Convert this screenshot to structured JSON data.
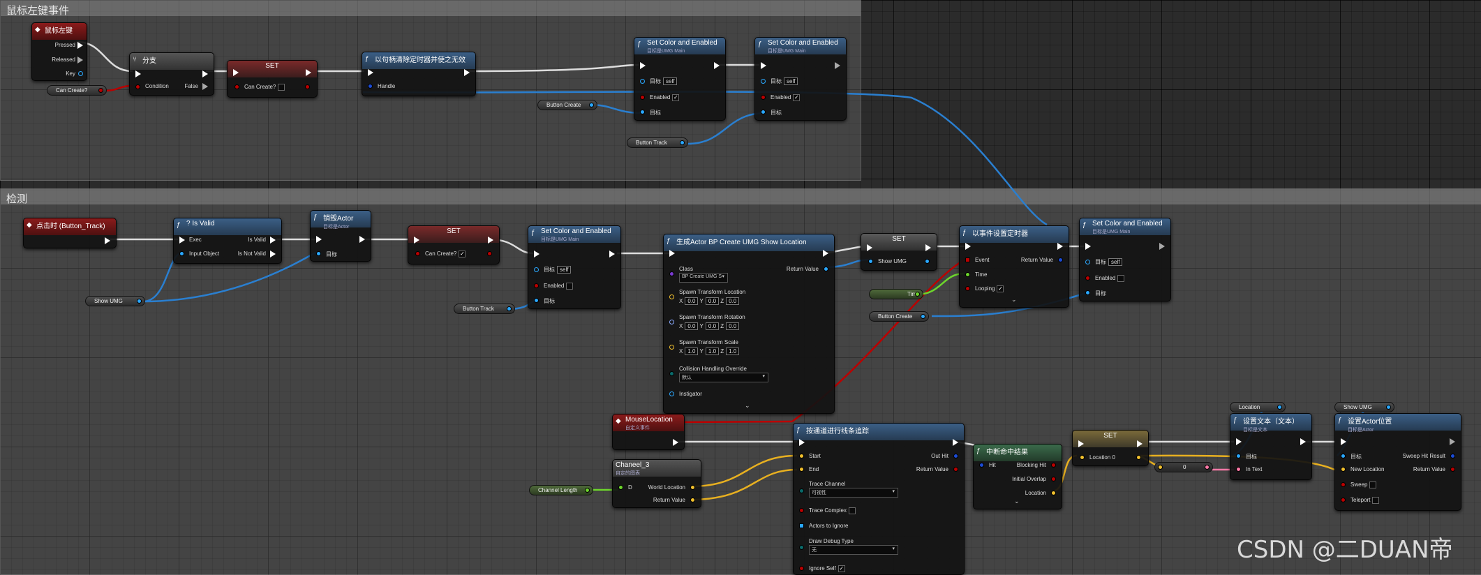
{
  "comments": {
    "top": "鼠标左键事件",
    "bottom": "检测"
  },
  "n1": {
    "title": "鼠标左键",
    "pressed": "Pressed",
    "released": "Released",
    "key": "Key"
  },
  "v_cancreate1": "Can Create?",
  "n2": {
    "title": "分支",
    "condition": "Condition",
    "false": "False"
  },
  "n3": {
    "title": "SET",
    "label": "Can Create?"
  },
  "n4": {
    "title": "以句柄清除定时器并使之无效",
    "handle": "Handle"
  },
  "n5": {
    "title": "Set Color and Enabled",
    "sub": "目标是UMG Main",
    "target": "目标",
    "self": "self",
    "enabled": "Enabled",
    "target2": "目标",
    "check": "✓"
  },
  "n6": {
    "title": "Set Color and Enabled",
    "sub": "目标是UMG Main",
    "target": "目标",
    "self": "self",
    "enabled": "Enabled",
    "target2": "目标",
    "check": "✓"
  },
  "v_btncreate1": "Button Create",
  "v_btntrack1": "Button Track",
  "b1": {
    "title": "点击时 (Button_Track)"
  },
  "b2": {
    "title": "? Is Valid",
    "exec": "Exec",
    "isvalid": "Is Valid",
    "input": "Input Object",
    "notvalid": "Is Not Valid"
  },
  "b3": {
    "title": "销毁Actor",
    "sub": "目标是Actor",
    "target": "目标"
  },
  "b4": {
    "title": "SET",
    "label": "Can Create?",
    "check": "✓"
  },
  "b5": {
    "title": "Set Color and Enabled",
    "sub": "目标是UMG Main",
    "target": "目标",
    "self": "self",
    "enabled": "Enabled",
    "target2": "目标"
  },
  "v_showumg1": "Show UMG",
  "v_btntrack2": "Button Track",
  "b6": {
    "title": "生成Actor BP Create UMG Show Location",
    "class": "Class",
    "classval": "BP Create UMG S",
    "returnv": "Return Value",
    "stl": "Spawn Transform Location",
    "str": "Spawn Transform Rotation",
    "sts": "Spawn Transform Scale",
    "x": "X",
    "y": "Y",
    "z": "Z",
    "v0": "0.0",
    "v1": "1.0",
    "coll": "Collision Handling Override",
    "collval": "默认",
    "instig": "Instigator"
  },
  "b7": {
    "title": "SET",
    "label": "Show UMG"
  },
  "b8": {
    "title": "以事件设置定时器",
    "event": "Event",
    "returnv": "Return Value",
    "time": "Time",
    "looping": "Looping",
    "check": "✓"
  },
  "b9": {
    "title": "Set Color and Enabled",
    "sub": "目标是UMG Main",
    "target": "目标",
    "self": "self",
    "enabled": "Enabled",
    "target2": "目标"
  },
  "v_time": "Time",
  "v_btncreate2": "Button Create",
  "c1": {
    "title": "MouseLocation",
    "sub": "自定义事件"
  },
  "c2": {
    "title": "Chaneel_3",
    "sub": "自定的图表",
    "d": "D",
    "wl": "World Location",
    "rv": "Return Value"
  },
  "v_chlen": "Channel Length",
  "c3": {
    "title": "按通道进行线条追踪",
    "start": "Start",
    "end": "End",
    "tc": "Trace Channel",
    "tcval": "可视性",
    "tcomplex": "Trace Complex",
    "ati": "Actors to Ignore",
    "ddt": "Draw Debug Type",
    "ddtval": "无",
    "ignself": "Ignore Self",
    "outhit": "Out Hit",
    "rv": "Return Value",
    "check": "✓"
  },
  "c4": {
    "title": "中断命中结果",
    "hit": "Hit",
    "blocking": "Blocking Hit",
    "initial": "Initial Overlap",
    "location": "Location"
  },
  "c5": {
    "title": "SET",
    "label": "Location 0"
  },
  "c6": {
    "label": "0"
  },
  "v_location": "Location",
  "c7": {
    "title": "设置文本（文本）",
    "sub": "目标是文本",
    "target": "目标",
    "intext": "In Text"
  },
  "v_showumg2": "Show UMG",
  "c8": {
    "title": "设置Actor位置",
    "sub": "目标是Actor",
    "target": "目标",
    "sweep": "Sweep Hit Result",
    "newloc": "New Location",
    "rv": "Return Value",
    "sweepl": "Sweep",
    "teleport": "Teleport"
  },
  "watermark": "CSDN @二DUAN帝",
  "colors": {
    "exec": "#ffffff",
    "object": "#2aa8ff",
    "bool": "#b00000",
    "float": "#6dd52c",
    "vector": "#f2c12e",
    "text": "#ff7aa8"
  }
}
